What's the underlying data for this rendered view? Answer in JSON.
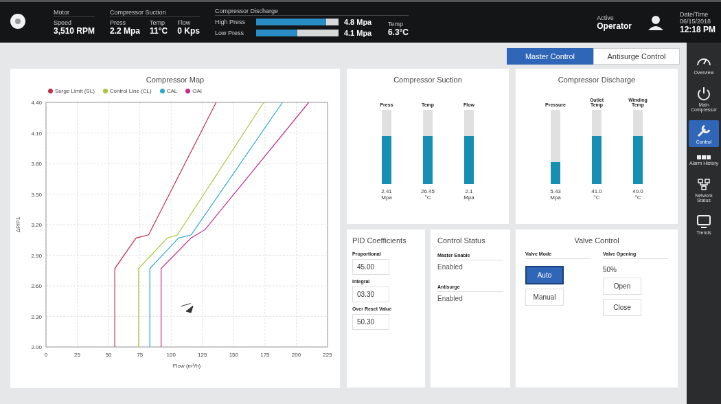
{
  "header": {
    "motor": {
      "title": "Motor",
      "stats": [
        {
          "label": "Speed",
          "value": "3,510 RPM"
        }
      ]
    },
    "suction": {
      "title": "Compressor Suction",
      "stats": [
        {
          "label": "Press",
          "value": "2.2 Mpa"
        },
        {
          "label": "Temp",
          "value": "11°C"
        },
        {
          "label": "Flow",
          "value": "0 Kps"
        }
      ]
    },
    "discharge": {
      "title": "Compressor Discharge",
      "bars": [
        {
          "label": "High Press",
          "level": 0.85,
          "value": "4.8 Mpa"
        },
        {
          "label": "Low Press",
          "level": 0.5,
          "value": "4.1 Mpa"
        }
      ],
      "stats": [
        {
          "label": "Temp",
          "value": "6.3°C"
        }
      ]
    },
    "user": {
      "label": "Active",
      "name": "Operator"
    },
    "clock": {
      "label": "Date/Time",
      "date": "06/15/2018",
      "time": "12:18 PM"
    }
  },
  "tabs": [
    {
      "label": "Master Control",
      "selected": true
    },
    {
      "label": "Antisurge Control",
      "selected": false
    }
  ],
  "compressor_map": {
    "chart_data": {
      "type": "line",
      "grid": true,
      "title": "Compressor Map",
      "xlabel": "Flow (m³/h)",
      "ylabel": "ΔP/P1",
      "xlim": [
        0,
        225
      ],
      "ylim": [
        2.0,
        4.4
      ],
      "xticks": [
        0,
        25,
        50,
        75,
        100,
        125,
        150,
        175,
        200,
        225
      ],
      "yticks": [
        {
          "value": 2.0,
          "label": "2.00"
        },
        {
          "value": 2.3,
          "label": "2.30"
        },
        {
          "value": 2.6,
          "label": "2.60"
        },
        {
          "value": 2.9,
          "label": "2.90"
        },
        {
          "value": 3.2,
          "label": "3.20"
        },
        {
          "value": 3.5,
          "label": "3.50"
        },
        {
          "value": 3.8,
          "label": "3.80"
        },
        {
          "value": 4.1,
          "label": "4.10"
        },
        {
          "value": 4.4,
          "label": "4.40"
        }
      ],
      "series": [
        {
          "name": "Surge Limit (SL)",
          "color": "#c0304a",
          "x": [
            55,
            55,
            72,
            82,
            136
          ],
          "values": [
            2.0,
            2.77,
            3.07,
            3.1,
            4.4
          ]
        },
        {
          "name": "Control Line (CL)",
          "color": "#a8c83c",
          "x": [
            74,
            74,
            97,
            105,
            174
          ],
          "values": [
            2.0,
            2.77,
            3.07,
            3.1,
            4.4
          ]
        },
        {
          "name": "CAL",
          "color": "#2aa8d0",
          "x": [
            83,
            83,
            106,
            116,
            189
          ],
          "values": [
            2.0,
            2.77,
            3.07,
            3.1,
            4.4
          ]
        },
        {
          "name": "OAI",
          "color": "#c02a8a",
          "x": [
            92,
            92,
            116,
            127,
            210
          ],
          "values": [
            2.0,
            2.77,
            3.07,
            3.15,
            4.4
          ]
        }
      ]
    }
  },
  "suction_panel": {
    "title": "Compressor Suction",
    "gauges": [
      {
        "label": "Press",
        "level": 0.65,
        "value": "2.41",
        "unit": "Mpa"
      },
      {
        "label": "Temp",
        "level": 0.65,
        "value": "26.45",
        "unit": "°C"
      },
      {
        "label": "Flow",
        "level": 0.65,
        "value": "2.1",
        "unit": "Mpa"
      }
    ]
  },
  "discharge_panel": {
    "title": "Compressor Discharge",
    "gauges": [
      {
        "label": "Pressure",
        "level": 0.3,
        "value": "5.43",
        "unit": "Mpa"
      },
      {
        "label": "Outlet Temp",
        "level": 0.65,
        "value": "41.0",
        "unit": "°C"
      },
      {
        "label": "Winding Temp",
        "level": 0.65,
        "value": "40.0",
        "unit": "°C"
      }
    ]
  },
  "pid": {
    "title": "PID Coefficients",
    "fields": [
      {
        "label": "Proportional",
        "value": "45.00"
      },
      {
        "label": "Integral",
        "value": "03.30"
      },
      {
        "label": "Over Reset Value",
        "value": "50.30"
      }
    ]
  },
  "control_status": {
    "title": "Control Status",
    "items": [
      {
        "label": "Master Enable",
        "value": "Enabled"
      },
      {
        "label": "Antisurge",
        "value": "Enabled"
      }
    ]
  },
  "valve": {
    "title": "Valve Control",
    "mode_label": "Valve Mode",
    "modes": [
      {
        "label": "Auto",
        "selected": true
      },
      {
        "label": "Manual",
        "selected": false
      }
    ],
    "opening_label": "Valve Opening",
    "opening": "50%",
    "actions": [
      "Open",
      "Close"
    ]
  },
  "nav": [
    {
      "label": "Overview",
      "kind": "gauge",
      "selected": false
    },
    {
      "label": "Main Compressor",
      "kind": "power",
      "selected": false
    },
    {
      "label": "Control",
      "kind": "wrench",
      "selected": true
    },
    {
      "label": "Alarm History",
      "kind": "dots",
      "selected": false
    },
    {
      "label": "Network Status",
      "kind": "network",
      "selected": false
    },
    {
      "label": "Trends",
      "kind": "screen",
      "selected": false
    }
  ]
}
